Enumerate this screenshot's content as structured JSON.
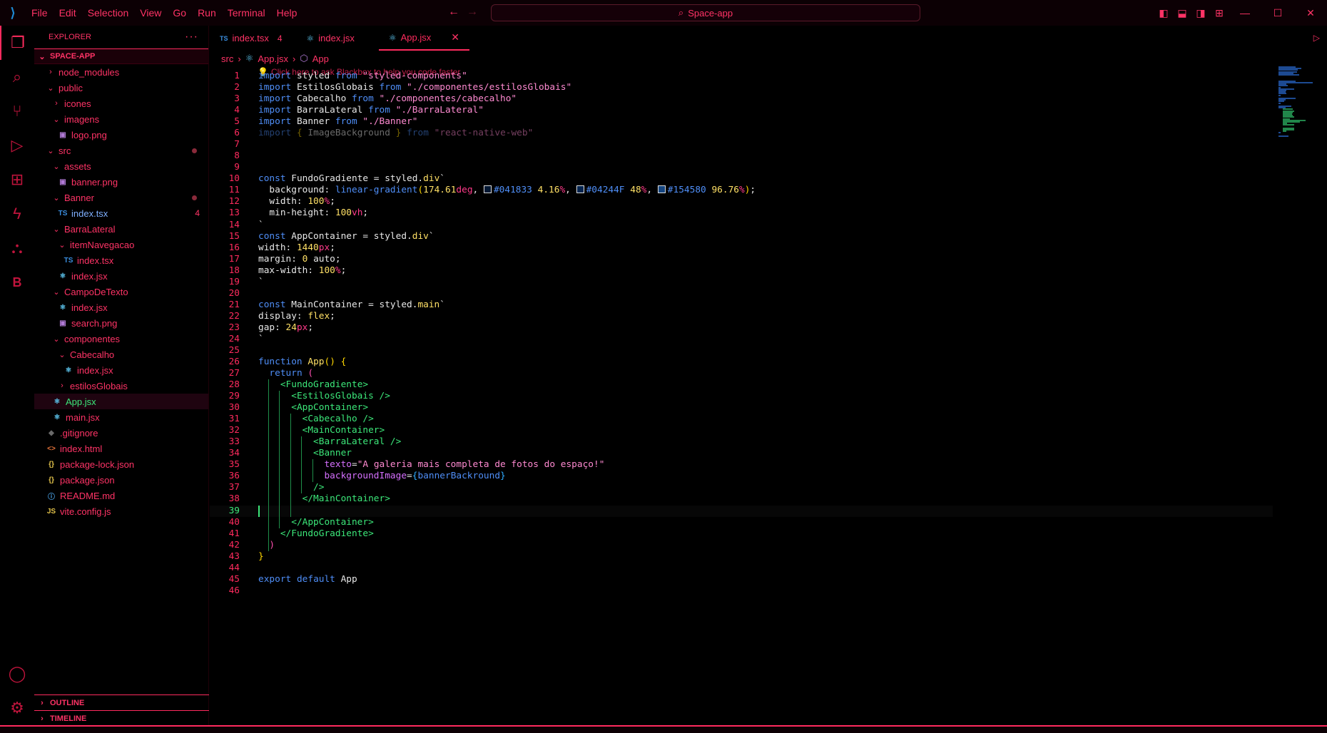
{
  "titlebar": {
    "menu": [
      "File",
      "Edit",
      "Selection",
      "View",
      "Go",
      "Run",
      "Terminal",
      "Help"
    ],
    "search_label": "Space-app"
  },
  "explorer": {
    "title": "EXPLORER",
    "more": "···",
    "project": "SPACE-APP",
    "tree": [
      {
        "label": "node_modules",
        "depth": 1,
        "type": "folder",
        "open": false
      },
      {
        "label": "public",
        "depth": 1,
        "type": "folder",
        "open": true
      },
      {
        "label": "icones",
        "depth": 2,
        "type": "folder",
        "open": false
      },
      {
        "label": "imagens",
        "depth": 2,
        "type": "folder",
        "open": true
      },
      {
        "label": "logo.png",
        "depth": 3,
        "type": "file",
        "icon": "image-icon"
      },
      {
        "label": "src",
        "depth": 1,
        "type": "folder",
        "open": true,
        "dot": true
      },
      {
        "label": "assets",
        "depth": 2,
        "type": "folder",
        "open": true
      },
      {
        "label": "banner.png",
        "depth": 3,
        "type": "file",
        "icon": "image-icon"
      },
      {
        "label": "Banner",
        "depth": 2,
        "type": "folder",
        "open": true,
        "dot": true
      },
      {
        "label": "index.tsx",
        "depth": 3,
        "type": "file",
        "icon": "ts-icon",
        "badge": "4"
      },
      {
        "label": "BarraLateral",
        "depth": 2,
        "type": "folder",
        "open": true
      },
      {
        "label": "itemNavegacao",
        "depth": 3,
        "type": "folder",
        "open": true
      },
      {
        "label": "index.tsx",
        "depth": 4,
        "type": "file",
        "icon": "ts-icon"
      },
      {
        "label": "index.jsx",
        "depth": 3,
        "type": "file",
        "icon": "react-icon"
      },
      {
        "label": "CampoDeTexto",
        "depth": 2,
        "type": "folder",
        "open": true
      },
      {
        "label": "index.jsx",
        "depth": 3,
        "type": "file",
        "icon": "react-icon"
      },
      {
        "label": "search.png",
        "depth": 3,
        "type": "file",
        "icon": "image-icon"
      },
      {
        "label": "componentes",
        "depth": 2,
        "type": "folder",
        "open": true
      },
      {
        "label": "Cabecalho",
        "depth": 3,
        "type": "folder",
        "open": true
      },
      {
        "label": "index.jsx",
        "depth": 4,
        "type": "file",
        "icon": "react-icon"
      },
      {
        "label": "estilosGlobais",
        "depth": 3,
        "type": "folder",
        "open": false
      },
      {
        "label": "App.jsx",
        "depth": 2,
        "type": "file",
        "icon": "react-icon",
        "selected": true
      },
      {
        "label": "main.jsx",
        "depth": 2,
        "type": "file",
        "icon": "react-icon"
      },
      {
        "label": ".gitignore",
        "depth": 1,
        "type": "file",
        "icon": "git-icon"
      },
      {
        "label": "index.html",
        "depth": 1,
        "type": "file",
        "icon": "html-icon"
      },
      {
        "label": "package-lock.json",
        "depth": 1,
        "type": "file",
        "icon": "json-icon"
      },
      {
        "label": "package.json",
        "depth": 1,
        "type": "file",
        "icon": "json-icon"
      },
      {
        "label": "README.md",
        "depth": 1,
        "type": "file",
        "icon": "info-icon"
      },
      {
        "label": "vite.config.js",
        "depth": 1,
        "type": "file",
        "icon": "js-icon"
      }
    ],
    "outline": "OUTLINE",
    "timeline": "TIMELINE"
  },
  "tabs": [
    {
      "label": "index.tsx",
      "icon": "ts-icon",
      "problems": "4",
      "active": false
    },
    {
      "label": "index.jsx",
      "icon": "react-icon",
      "active": false
    },
    {
      "label": "App.jsx",
      "icon": "react-icon",
      "active": true
    }
  ],
  "breadcrumb": {
    "folder": "src",
    "file": "App.jsx",
    "symbol": "App"
  },
  "editor": {
    "hint": "Click here to ask Blackbox to help you code faster",
    "current_line": 39,
    "line_count": 46
  },
  "icons": {
    "ts": "TS",
    "js": "JS",
    "json": "{}",
    "html": "<>",
    "react": "⚛",
    "image": "▣",
    "git": "◆",
    "info": "ⓘ"
  },
  "colors": {
    "accent": "#ff2b5e",
    "background": "#000000",
    "cursor": "#3ce87a"
  }
}
